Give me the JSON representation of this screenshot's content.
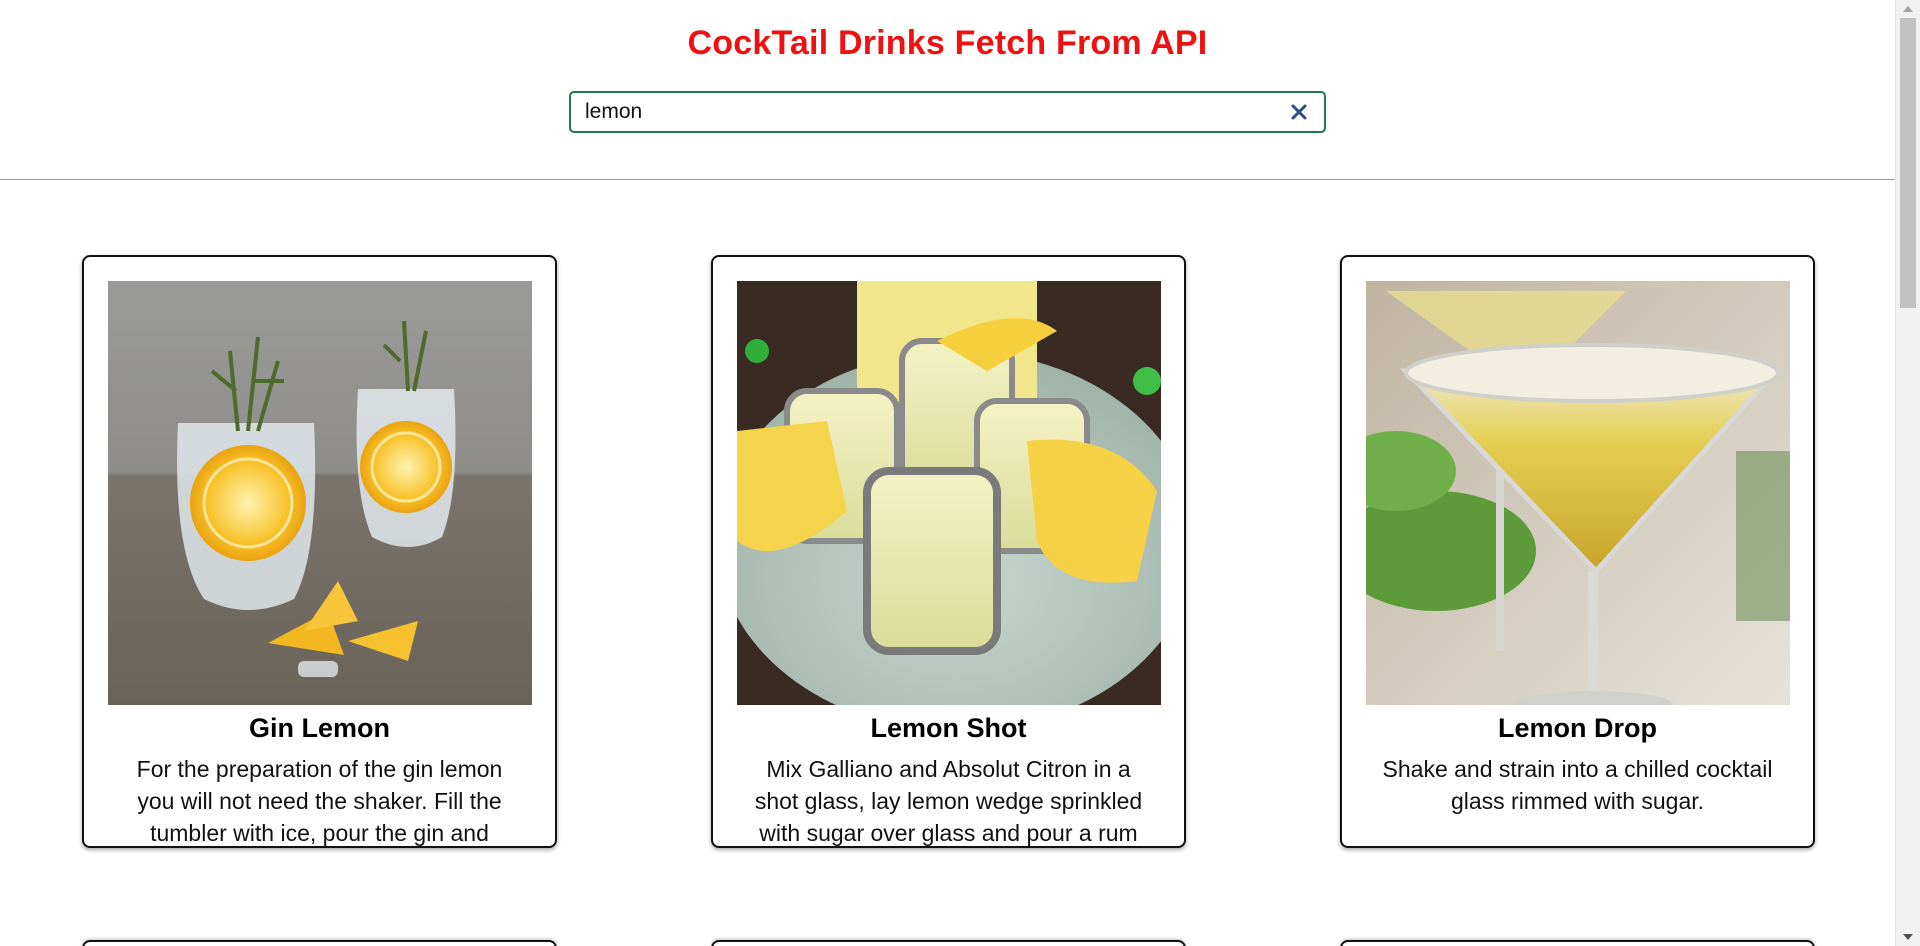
{
  "header": {
    "title": "CockTail Drinks Fetch From API",
    "title_color": "#ee1111"
  },
  "search": {
    "value": "lemon",
    "clear_icon": "close-icon",
    "border_color": "#1e7a46"
  },
  "drinks": [
    {
      "name": "Gin Lemon",
      "description": "For the preparation of the gin lemon you will not need the shaker. Fill the tumbler with ice, pour the gin and"
    },
    {
      "name": "Lemon Shot",
      "description": "Mix Galliano and Absolut Citron in a shot glass, lay lemon wedge sprinkled with sugar over glass and pour a rum"
    },
    {
      "name": "Lemon Drop",
      "description": "Shake and strain into a chilled cocktail glass rimmed with sugar."
    }
  ]
}
